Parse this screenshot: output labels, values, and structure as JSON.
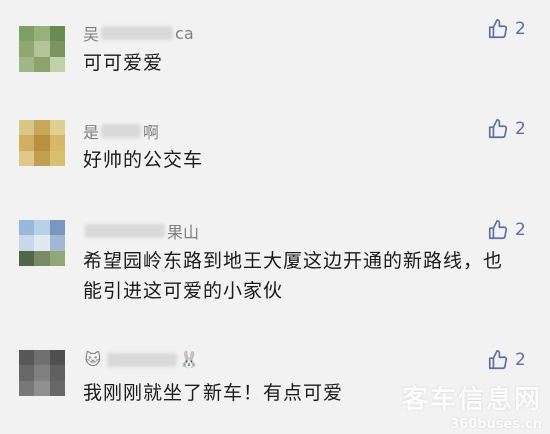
{
  "comments": [
    {
      "name_visible_start": "吴",
      "name_visible_end": "ca",
      "text": "可可爱爱",
      "likes": "2",
      "avatar_colors": [
        "#7fa064",
        "#98b07a",
        "#6a8a55",
        "#8ea870",
        "#b3c49a",
        "#7a9560",
        "#a0b888",
        "#8aa46c",
        "#c0d0a8"
      ]
    },
    {
      "name_visible_start": "是",
      "name_visible_end": "啊",
      "text": "好帅的公交车",
      "likes": "2",
      "avatar_colors": [
        "#d8c888",
        "#c8a858",
        "#e0d090",
        "#d0b060",
        "#b89040",
        "#d8b868",
        "#e0c888",
        "#c0a050",
        "#d8c070"
      ]
    },
    {
      "name_visible_start": "",
      "name_visible_end": "果山",
      "text": "希望园岭东路到地王大厦这边开通的新路线，也能引进这可爱的小家伙",
      "likes": "2",
      "avatar_colors": [
        "#9ab8d8",
        "#b8d0e8",
        "#7898c0",
        "#c8d8e8",
        "#e0e8f0",
        "#a0b8d0",
        "#506848",
        "#7a8a68",
        "#90a878"
      ]
    },
    {
      "name_visible_start": "",
      "name_visible_end": "",
      "emoji_start": "🐱",
      "emoji_end": "🐰",
      "text": "我刚刚就坐了新车！有点可爱",
      "likes": "2",
      "avatar_colors": [
        "#585858",
        "#707070",
        "#505050",
        "#686868",
        "#808080",
        "#606060",
        "#787878",
        "#909090",
        "#686868"
      ]
    }
  ],
  "watermark": {
    "title": "客车信息网",
    "url": "360buses.cn"
  },
  "like_icon": "thumbs-up-icon",
  "colors": {
    "background": "#f2f2f2",
    "like": "#5a6fa0",
    "name": "#7f7f7f",
    "text": "#1a1a1a"
  }
}
